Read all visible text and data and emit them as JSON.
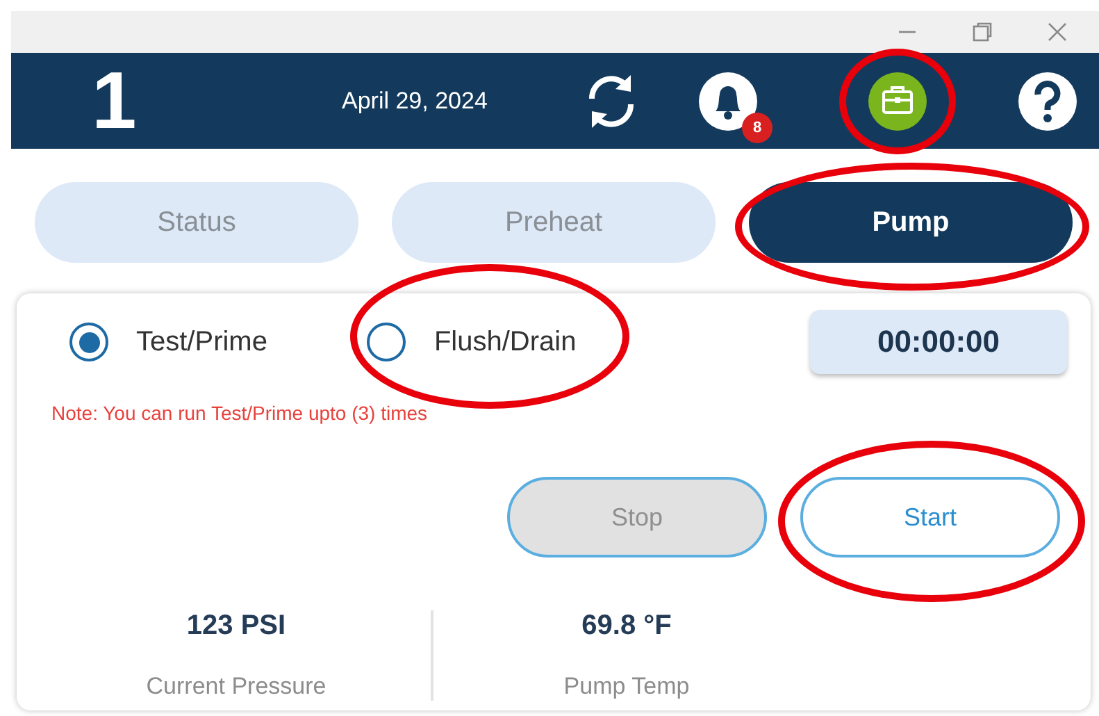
{
  "window": {
    "controls": [
      {
        "kind": "minimize"
      },
      {
        "kind": "restore"
      },
      {
        "kind": "close"
      }
    ]
  },
  "header": {
    "title": "1",
    "date": "April 29, 2024",
    "icons": [
      {
        "kind": "sync",
        "circled": false
      },
      {
        "kind": "bell",
        "badge": "8",
        "circled": false
      },
      {
        "kind": "toolbox",
        "circled": true
      },
      {
        "kind": "help",
        "circled": false
      }
    ]
  },
  "tabs": [
    {
      "label": "Status",
      "selected": false,
      "circled": false
    },
    {
      "label": "Preheat",
      "selected": false,
      "circled": false
    },
    {
      "label": "Pump",
      "selected": true,
      "circled": true
    }
  ],
  "modes": [
    {
      "label": "Test/Prime",
      "selected": true,
      "circled": false
    },
    {
      "label": "Flush/Drain",
      "selected": false,
      "circled": true
    }
  ],
  "timer": "00:00:00",
  "note": "Note: You can run Test/Prime upto (3) times",
  "buttons": [
    {
      "label": "Stop",
      "disabled": true,
      "circled": false
    },
    {
      "label": "Start",
      "disabled": false,
      "circled": true
    }
  ],
  "readings": [
    {
      "value": "123 PSI",
      "label": "Current Pressure"
    },
    {
      "value": "69.8 °F",
      "label": "Pump Temp"
    }
  ]
}
